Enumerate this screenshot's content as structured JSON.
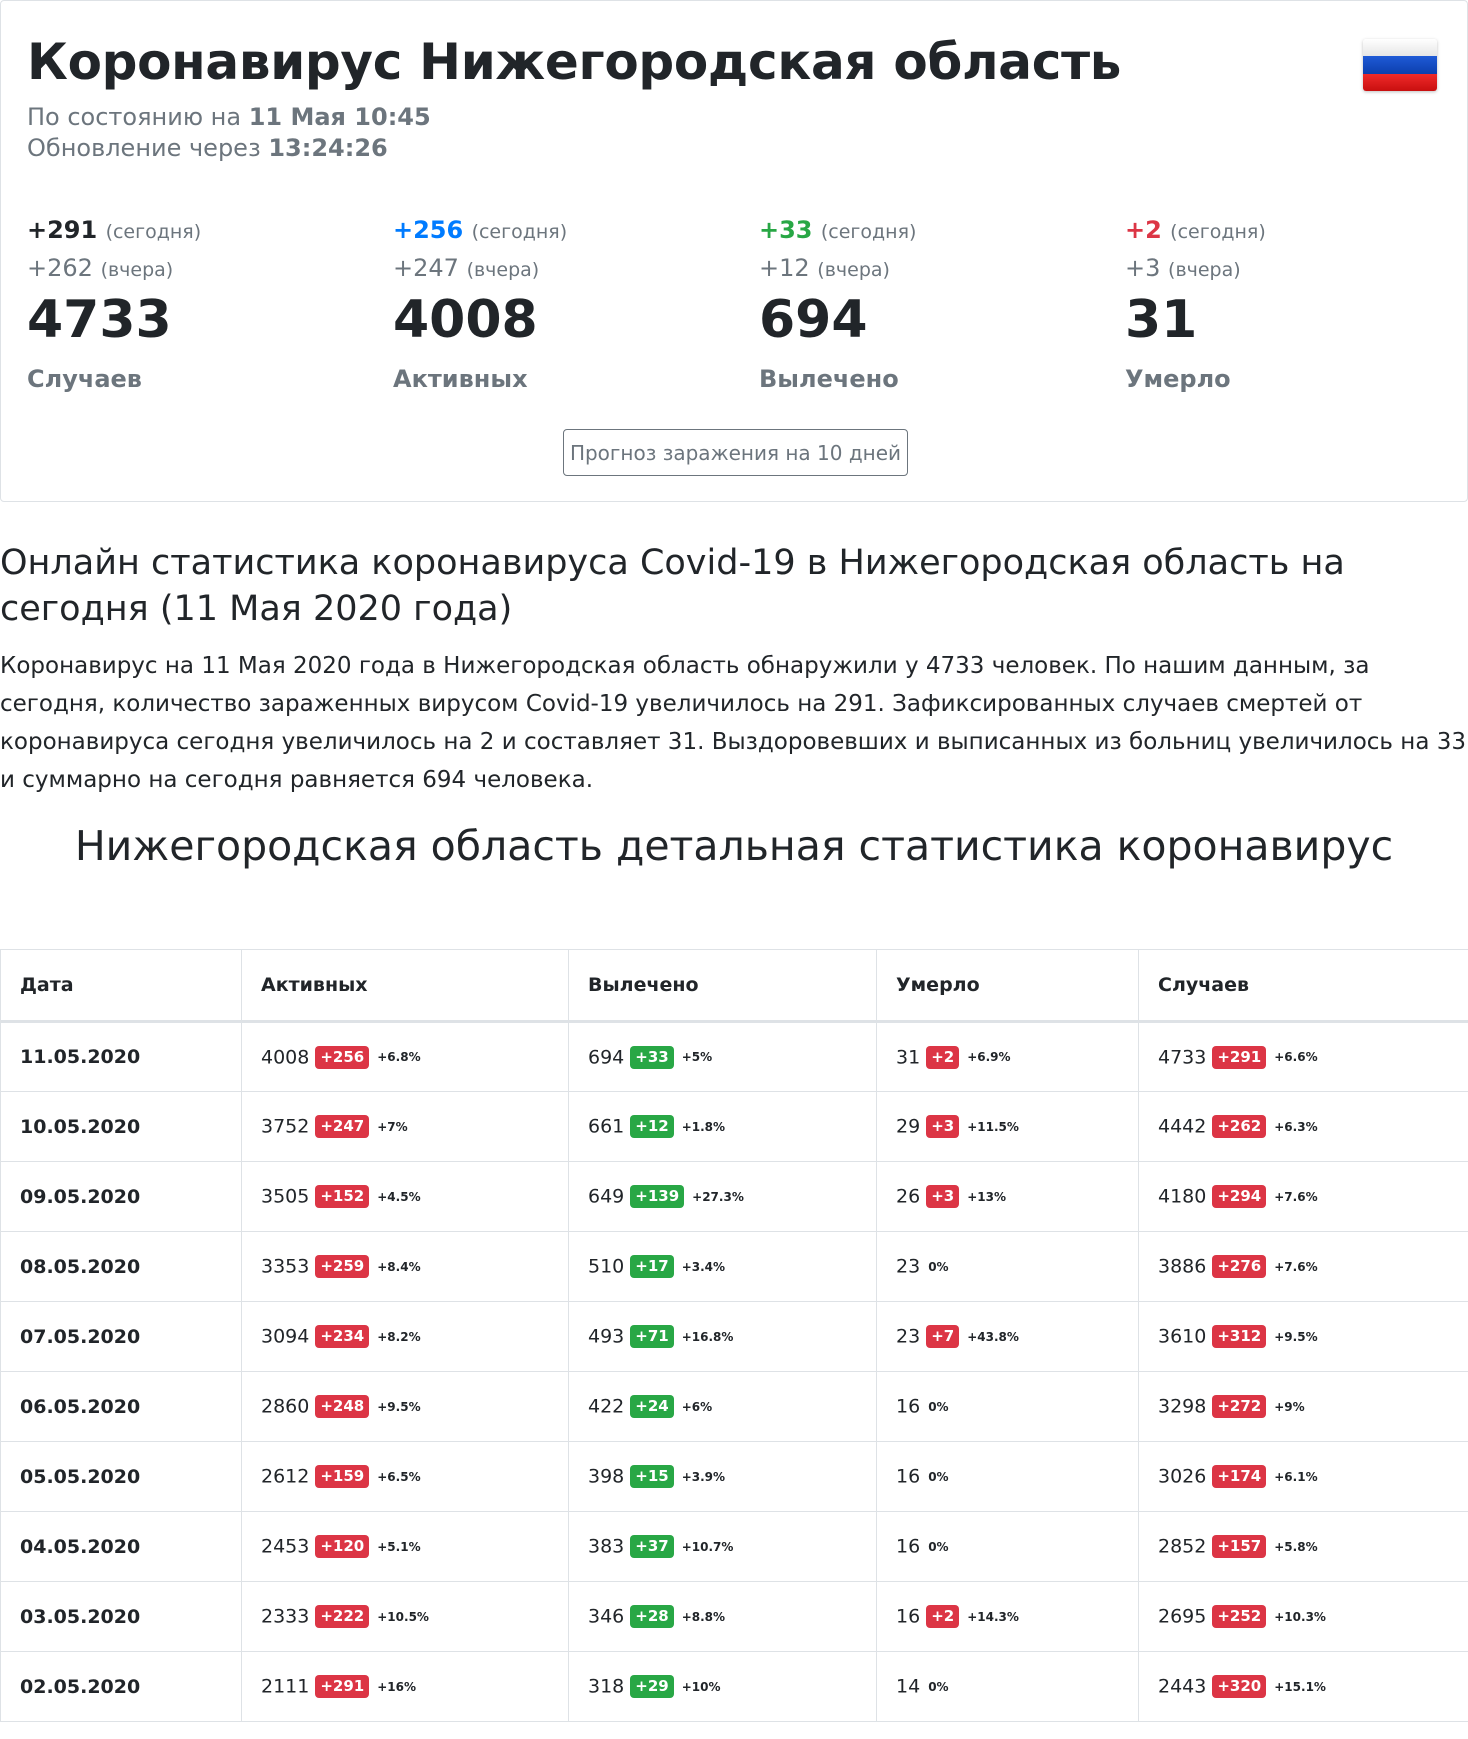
{
  "header": {
    "title": "Коронавирус Нижегородская область",
    "status_prefix": "По состоянию на",
    "status_value": "11 Мая 10:45",
    "update_prefix": "Обновление через",
    "update_value": "13:24:26",
    "flag_icon": "russia-flag-icon"
  },
  "stats": [
    {
      "today": "+291",
      "today_suffix": "(сегодня)",
      "yesterday": "+262",
      "yesterday_suffix": "(вчера)",
      "total": "4733",
      "label": "Случаев",
      "color": "#212529"
    },
    {
      "today": "+256",
      "today_suffix": "(сегодня)",
      "yesterday": "+247",
      "yesterday_suffix": "(вчера)",
      "total": "4008",
      "label": "Активных",
      "color": "#007bff"
    },
    {
      "today": "+33",
      "today_suffix": "(сегодня)",
      "yesterday": "+12",
      "yesterday_suffix": "(вчера)",
      "total": "694",
      "label": "Вылечено",
      "color": "#28a745"
    },
    {
      "today": "+2",
      "today_suffix": "(сегодня)",
      "yesterday": "+3",
      "yesterday_suffix": "(вчера)",
      "total": "31",
      "label": "Умерло",
      "color": "#dc3545"
    }
  ],
  "forecast_button": "Прогноз заражения на 10 дней",
  "online_heading": "Онлайн статистика коронавируса Covid-19 в Нижегородская область на сегодня (11 Мая 2020 года)",
  "paragraph": "Коронавирус на 11 Мая 2020 года в Нижегородская область обнаружили у 4733 человек. По нашим данным, за сегодня, количество зараженных вирусом Covid-19 увеличилось на 291. Зафиксированных случаев смертей от коронавируса сегодня увеличилось на 2 и составляет 31. Выздоровевших и выписанных из больниц увеличилось на 33 и суммарно на сегодня равняется 694 человека.",
  "detail_heading": "Нижегородская область детальная статистика коронавирус",
  "table": {
    "headers": [
      "Дата",
      "Активных",
      "Вылечено",
      "Умерло",
      "Случаев"
    ],
    "rows": [
      {
        "date": "11.05.2020",
        "active": [
          "4008",
          "+256",
          "+6.8%"
        ],
        "recovered": [
          "694",
          "+33",
          "+5%"
        ],
        "died": [
          "31",
          "+2",
          "+6.9%"
        ],
        "cases": [
          "4733",
          "+291",
          "+6.6%"
        ]
      },
      {
        "date": "10.05.2020",
        "active": [
          "3752",
          "+247",
          "+7%"
        ],
        "recovered": [
          "661",
          "+12",
          "+1.8%"
        ],
        "died": [
          "29",
          "+3",
          "+11.5%"
        ],
        "cases": [
          "4442",
          "+262",
          "+6.3%"
        ]
      },
      {
        "date": "09.05.2020",
        "active": [
          "3505",
          "+152",
          "+4.5%"
        ],
        "recovered": [
          "649",
          "+139",
          "+27.3%"
        ],
        "died": [
          "26",
          "+3",
          "+13%"
        ],
        "cases": [
          "4180",
          "+294",
          "+7.6%"
        ]
      },
      {
        "date": "08.05.2020",
        "active": [
          "3353",
          "+259",
          "+8.4%"
        ],
        "recovered": [
          "510",
          "+17",
          "+3.4%"
        ],
        "died": [
          "23",
          "",
          "0%"
        ],
        "cases": [
          "3886",
          "+276",
          "+7.6%"
        ]
      },
      {
        "date": "07.05.2020",
        "active": [
          "3094",
          "+234",
          "+8.2%"
        ],
        "recovered": [
          "493",
          "+71",
          "+16.8%"
        ],
        "died": [
          "23",
          "+7",
          "+43.8%"
        ],
        "cases": [
          "3610",
          "+312",
          "+9.5%"
        ]
      },
      {
        "date": "06.05.2020",
        "active": [
          "2860",
          "+248",
          "+9.5%"
        ],
        "recovered": [
          "422",
          "+24",
          "+6%"
        ],
        "died": [
          "16",
          "",
          "0%"
        ],
        "cases": [
          "3298",
          "+272",
          "+9%"
        ]
      },
      {
        "date": "05.05.2020",
        "active": [
          "2612",
          "+159",
          "+6.5%"
        ],
        "recovered": [
          "398",
          "+15",
          "+3.9%"
        ],
        "died": [
          "16",
          "",
          "0%"
        ],
        "cases": [
          "3026",
          "+174",
          "+6.1%"
        ]
      },
      {
        "date": "04.05.2020",
        "active": [
          "2453",
          "+120",
          "+5.1%"
        ],
        "recovered": [
          "383",
          "+37",
          "+10.7%"
        ],
        "died": [
          "16",
          "",
          "0%"
        ],
        "cases": [
          "2852",
          "+157",
          "+5.8%"
        ]
      },
      {
        "date": "03.05.2020",
        "active": [
          "2333",
          "+222",
          "+10.5%"
        ],
        "recovered": [
          "346",
          "+28",
          "+8.8%"
        ],
        "died": [
          "16",
          "+2",
          "+14.3%"
        ],
        "cases": [
          "2695",
          "+252",
          "+10.3%"
        ]
      },
      {
        "date": "02.05.2020",
        "active": [
          "2111",
          "+291",
          "+16%"
        ],
        "recovered": [
          "318",
          "+29",
          "+10%"
        ],
        "died": [
          "14",
          "",
          "0%"
        ],
        "cases": [
          "2443",
          "+320",
          "+15.1%"
        ]
      }
    ]
  },
  "colors": {
    "red": "#dc3545",
    "green": "#28a745",
    "blue": "#007bff",
    "muted": "#6c757d"
  }
}
